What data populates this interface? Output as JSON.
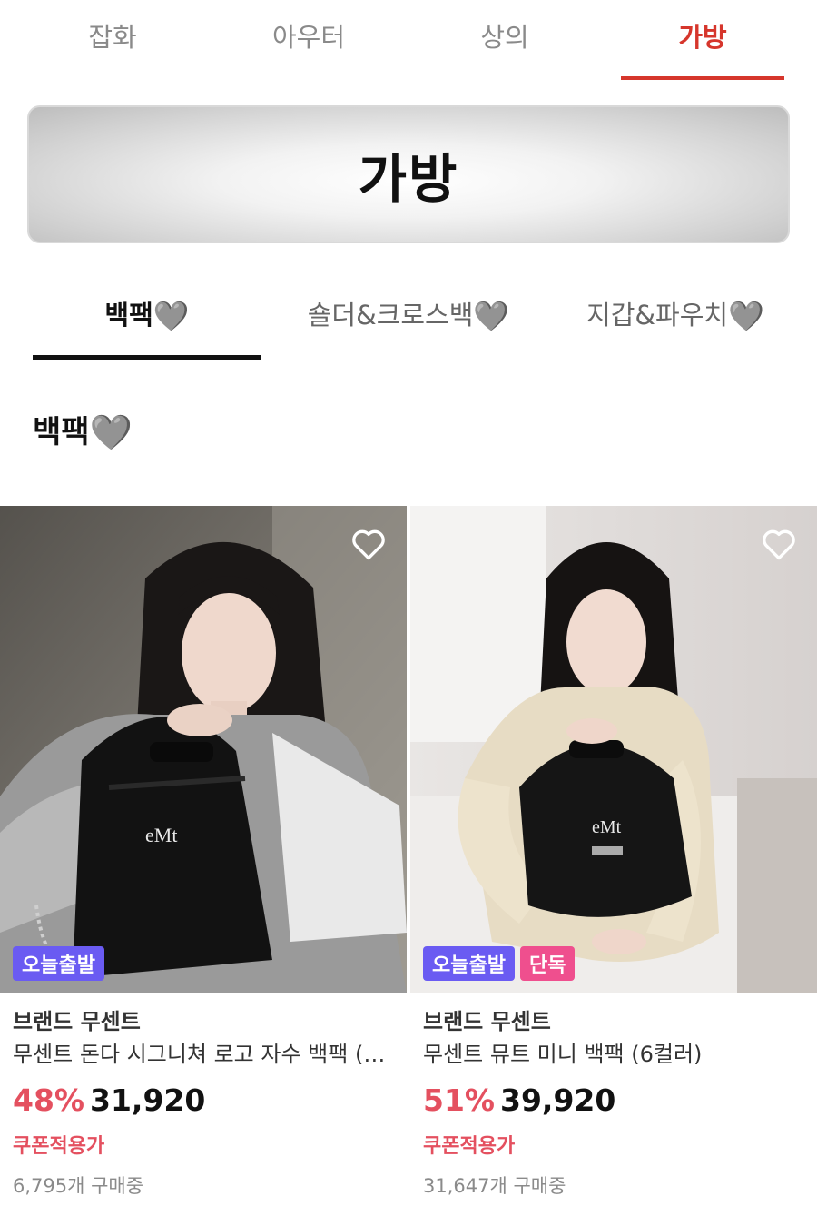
{
  "top_tabs": [
    {
      "label": "잡화",
      "active": false
    },
    {
      "label": "아우터",
      "active": false
    },
    {
      "label": "상의",
      "active": false
    },
    {
      "label": "가방",
      "active": true
    }
  ],
  "banner": {
    "title": "가방"
  },
  "sub_tabs": [
    {
      "label": "백팩",
      "active": true
    },
    {
      "label": "숄더&크로스백",
      "active": false
    },
    {
      "label": "지갑&파우치",
      "active": false
    }
  ],
  "section": {
    "title": "백팩"
  },
  "heart_emoji": "🩶",
  "colors": {
    "accent_red": "#d6362c",
    "discount_red": "#e4505f",
    "badge_purple": "#6a5bf2",
    "badge_pink": "#ef4f8e"
  },
  "products": [
    {
      "brand": "브랜드 무센트",
      "name": "무센트 돈다 시그니쳐 로고 자수 백팩 (…",
      "discount": "48%",
      "price": "31,920",
      "coupon": "쿠폰적용가",
      "buyers": "6,795개 구매중",
      "badges": [
        "오늘출발"
      ],
      "photo_logo": "eMt",
      "wishlist_icon": "heart-outline-icon"
    },
    {
      "brand": "브랜드 무센트",
      "name": "무센트 뮤트 미니 백팩 (6컬러)",
      "discount": "51%",
      "price": "39,920",
      "coupon": "쿠폰적용가",
      "buyers": "31,647개 구매중",
      "badges": [
        "오늘출발",
        "단독"
      ],
      "photo_logo": "eMt",
      "wishlist_icon": "heart-outline-icon"
    }
  ]
}
